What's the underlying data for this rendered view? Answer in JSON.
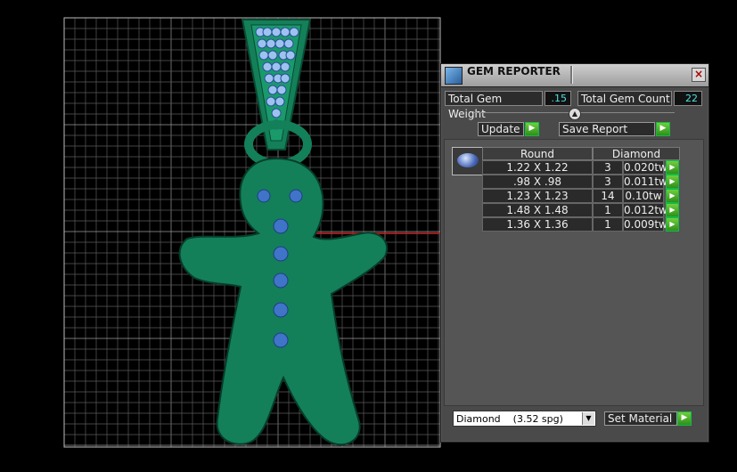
{
  "panel": {
    "title": "GEM REPORTER",
    "close_icon": "×",
    "total_gem_weight_label": "Total Gem Weight",
    "total_gem_weight_value": ".15",
    "total_gem_count_label": "Total Gem Count",
    "total_gem_count_value": "22",
    "update_label": "Update",
    "save_report_label": "Save Report",
    "table": {
      "headers": [
        "Round",
        "Diamond"
      ],
      "rows": [
        {
          "size": "1.22 X 1.22",
          "count": "3",
          "weight": "0.020tw"
        },
        {
          "size": ".98 X .98",
          "count": "3",
          "weight": "0.011tw"
        },
        {
          "size": "1.23 X 1.23",
          "count": "14",
          "weight": "0.10tw"
        },
        {
          "size": "1.48 X 1.48",
          "count": "1",
          "weight": "0.012tw"
        },
        {
          "size": "1.36 X 1.36",
          "count": "1",
          "weight": "0.009tw"
        }
      ]
    },
    "material_value": "Diamond    (3.52 spg)",
    "set_material_label": "Set Material"
  },
  "colors": {
    "model_green": "#13805a",
    "button_blue": "#3f74c8",
    "grid": "#8a8a8a",
    "axis_red": "#cc2222",
    "value_cyan": "#4fe0e0"
  }
}
